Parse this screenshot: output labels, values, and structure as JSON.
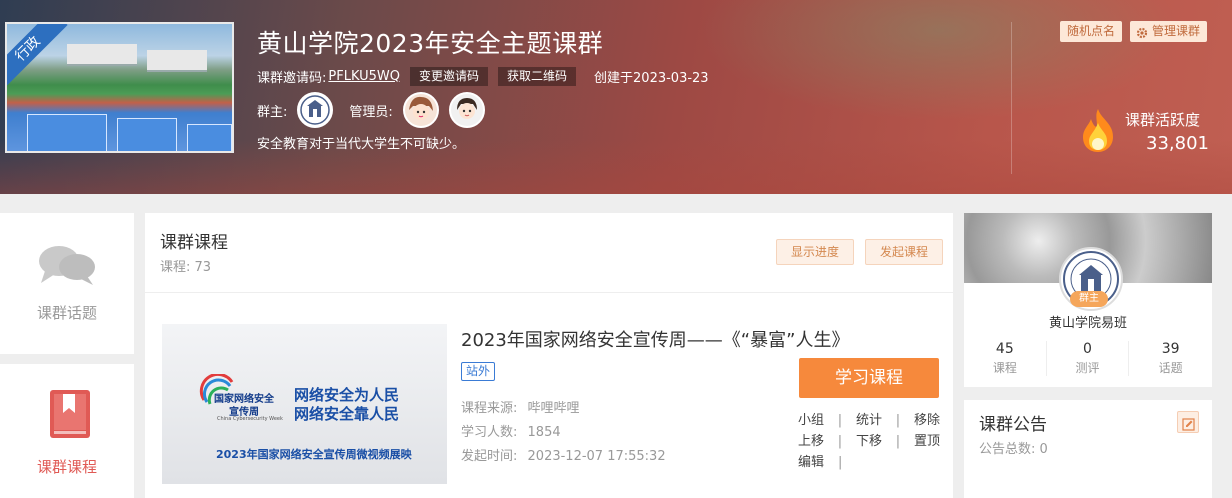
{
  "header": {
    "thumb_tag": "行政",
    "title": "黄山学院2023年安全主题课群",
    "invite_label": "课群邀请码:",
    "invite_code": "PFLKU5WQ",
    "change_code_btn": "变更邀请码",
    "qrcode_btn": "获取二维码",
    "created": "创建于2023-03-23",
    "owner_label": "群主:",
    "admin_label": "管理员:",
    "description": "安全教育对于当代大学生不可缺少。",
    "random_call_btn": "随机点名",
    "manage_btn": "管理课群",
    "activity_label": "课群活跃度",
    "activity_value": "33,801"
  },
  "left_nav": {
    "topics_label": "课群话题",
    "courses_label": "课群课程"
  },
  "main": {
    "heading": "课群课程",
    "count_text": "课程: 73",
    "show_progress_btn": "显示进度",
    "start_course_btn": "发起课程",
    "course": {
      "title": "2023年国家网络安全宣传周——《“暴富”人生》",
      "tag": "站外",
      "source_label": "课程来源:",
      "source": "哔哩哔哩",
      "learners_label": "学习人数:",
      "learners": "1854",
      "time_label": "发起时间:",
      "time": "2023-12-07 17:55:32",
      "learn_btn": "学习课程",
      "cover_logo_line1": "国家网络安全",
      "cover_logo_line2": "宣传周",
      "cover_logo_en": "China Cybersecurity Week",
      "cover_slogan1": "网络安全为人民",
      "cover_slogan2": "网络安全靠人民",
      "cover_bottom": "2023年国家网络安全宣传周微视频展映",
      "ops": {
        "group": "小组",
        "stats": "统计",
        "remove": "移除",
        "up": "上移",
        "down": "下移",
        "top": "置顶",
        "edit": "编辑"
      }
    }
  },
  "right": {
    "owner_badge": "群主",
    "owner_name": "黄山学院易班",
    "stats": [
      {
        "num": "45",
        "label": "课程"
      },
      {
        "num": "0",
        "label": "测评"
      },
      {
        "num": "39",
        "label": "话题"
      }
    ],
    "notice_title": "课群公告",
    "notice_count": "公告总数: 0"
  },
  "colors": {
    "accent": "#f6893c",
    "banner": "#a84a44",
    "courses_icon": "#e05a55",
    "link_tag": "#3a7bd5"
  }
}
